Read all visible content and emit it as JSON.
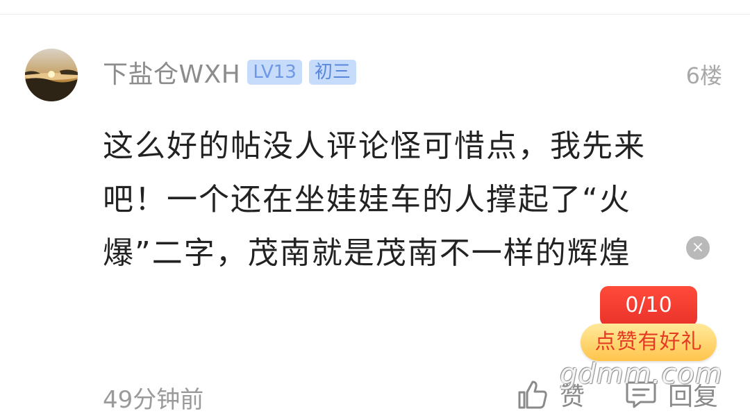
{
  "post": {
    "username": "下盐仓WXH",
    "level_badge": "LV13",
    "grade_badge": "初三",
    "floor": "6楼",
    "content": "这么好的帖没人评论怪可惜点，我先来吧！一个还在坐娃娃车的人撑起了“火爆”二字，茂南就是茂南不一样的辉煌",
    "timestamp": "49分钟前",
    "avatar_icon": "sunset-avatar"
  },
  "promo": {
    "counter": "0/10",
    "label": "点赞有好礼",
    "close_glyph": "×"
  },
  "actions": {
    "like_label": "赞",
    "reply_label": "回复"
  },
  "watermark": "gdmm.com",
  "colors": {
    "badge_bg": "#c7dcfb",
    "promo_red": "#e9322a",
    "promo_gold": "#ffc44d"
  }
}
